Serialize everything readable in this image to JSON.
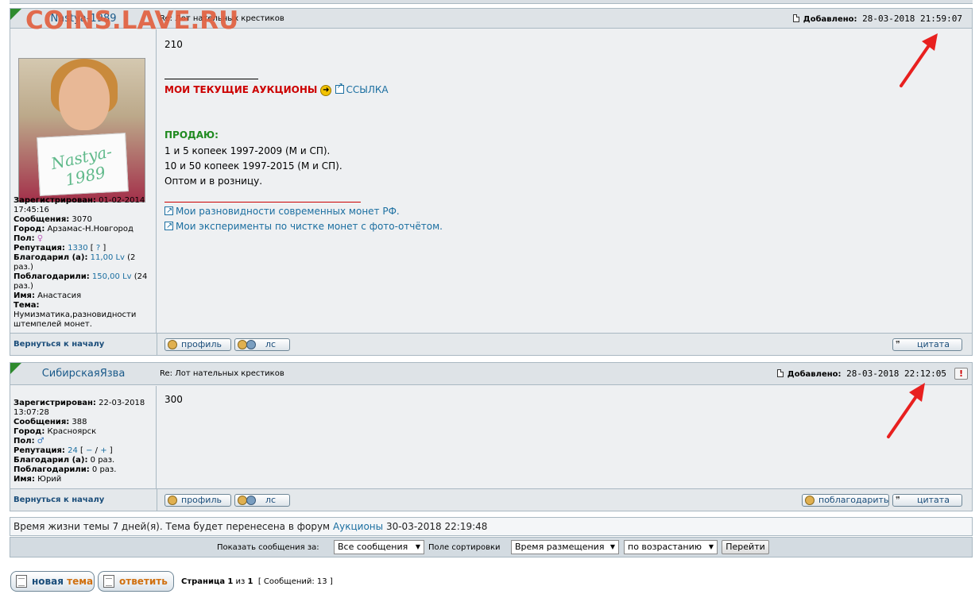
{
  "watermark": "COINS.LAVE.RU",
  "posts": [
    {
      "author": "Nastya-1989",
      "subject": "Re: Лот нательных крестиков",
      "added_label": "Добавлено:",
      "added_time": "28-03-2018 21:59:07",
      "avatar_sign": "Nastya-1989",
      "info": {
        "registered_label": "Зарегистрирован:",
        "registered": "01-02-2014 17:45:16",
        "messages_label": "Сообщения:",
        "messages": "3070",
        "city_label": "Город:",
        "city": "Арзамас-Н.Новгород",
        "sex_label": "Пол:",
        "sex_icon": "female-icon",
        "reputation_label": "Репутация:",
        "reputation": "1330",
        "reputation_extra": "?",
        "thanked_label": "Благодарил (а):",
        "thanked_value": "11,00 Lv",
        "thanked_times": "(2 раз.)",
        "thanks_got_label": "Поблагодарили:",
        "thanks_got_value": "150,00 Lv",
        "thanks_got_times": "(24 раз.)",
        "name_label": "Имя:",
        "name": "Анастасия",
        "theme_label": "Тема:",
        "theme": "Нумизматика,разновидности штемпелей монет."
      },
      "body": {
        "text_main": "210",
        "auctions_label": "МОИ ТЕКУЩИЕ АУКЦИОНЫ",
        "auctions_link": "ССЫЛКА",
        "sell_label": "ПРОДАЮ:",
        "sell_lines": [
          "1 и 5 копеек 1997-2009 (М и СП).",
          "10 и 50 копеек 1997-2015 (М и СП).",
          "Оптом и в розницу."
        ],
        "links": [
          "Мои разновидности современных монет РФ.",
          "Мои эксперименты по чистке монет с фото-отчётом."
        ]
      },
      "footer": {
        "back": "Вернуться к началу",
        "profile": "профиль",
        "pm": "лс",
        "quote": "цитата"
      }
    },
    {
      "author": "СибирскаяЯзва",
      "subject": "Re: Лот нательных крестиков",
      "added_label": "Добавлено:",
      "added_time": "28-03-2018 22:12:05",
      "report": "!",
      "info": {
        "registered_label": "Зарегистрирован:",
        "registered": "22-03-2018 13:07:28",
        "messages_label": "Сообщения:",
        "messages": "388",
        "city_label": "Город:",
        "city": "Красноярск",
        "sex_label": "Пол:",
        "sex_icon": "male-icon",
        "reputation_label": "Репутация:",
        "reputation": "24",
        "reputation_minus": "−",
        "reputation_plus": "+",
        "thanked_label": "Благодарил (а):",
        "thanked_value": "0 раз.",
        "thanks_got_label": "Поблагодарили:",
        "thanks_got_value": "0 раз.",
        "name_label": "Имя:",
        "name": "Юрий"
      },
      "body": {
        "text_main": "300"
      },
      "footer": {
        "back": "Вернуться к началу",
        "profile": "профиль",
        "pm": "лс",
        "thank": "поблагодарить",
        "quote": "цитата"
      }
    }
  ],
  "notice": {
    "text_before": "Время жизни темы 7 дней(я). Тема будет перенесена в форум",
    "forum_link": "Аукционы",
    "text_after": "30-03-2018 22:19:48"
  },
  "sortbar": {
    "show_label": "Показать сообщения за:",
    "show_value": "Все сообщения",
    "sort_label": "Поле сортировки",
    "sort_value": "Время размещения",
    "order_value": "по возрастанию",
    "go": "Перейти"
  },
  "bottom": {
    "new_topic_a": "новая",
    "new_topic_b": "тема",
    "reply": "ответить",
    "page_label": "Страница",
    "page_current": "1",
    "page_of": "из",
    "page_total": "1",
    "messages_count": "[ Сообщений: 13 ]"
  },
  "colors": {
    "header_bg": "#dee3e7",
    "post_bg": "#eef0f2",
    "border": "#a9b8c2",
    "link": "#1a6ea0",
    "auction_red": "#cc0000",
    "sell_green": "#1f8a1f",
    "arrow_red": "#e8201f"
  }
}
